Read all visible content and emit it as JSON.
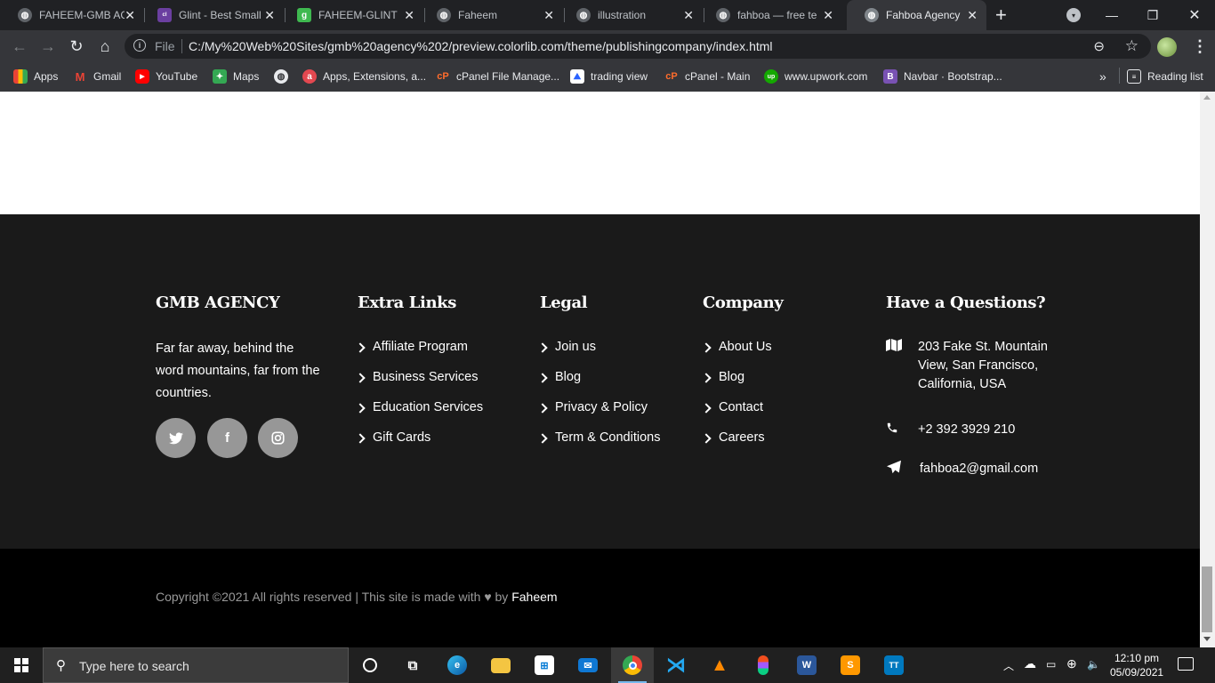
{
  "browser": {
    "tabs": [
      {
        "title": "FAHEEM-GMB AGENCY",
        "favicon": "globe-icon",
        "active": false
      },
      {
        "title": "Glint - Best Small",
        "favicon": "colorlib-icon",
        "active": false
      },
      {
        "title": "FAHEEM-GLINT",
        "favicon": "g-icon",
        "active": false
      },
      {
        "title": "Faheem",
        "favicon": "globe-icon",
        "active": false
      },
      {
        "title": "illustration",
        "favicon": "globe-icon",
        "active": false
      },
      {
        "title": "fahboa — free templates",
        "favicon": "globe-icon",
        "active": false
      },
      {
        "title": "Fahboa Agency",
        "favicon": "globe-icon",
        "active": true
      }
    ],
    "omnibox": {
      "scheme_label": "File",
      "url": "C:/My%20Web%20Sites/gmb%20agency%202/preview.colorlib.com/theme/publishingcompany/index.html"
    },
    "bookmarks": [
      {
        "label": "Apps",
        "icon": "apps-grid-icon",
        "color": "#ea4335"
      },
      {
        "label": "Gmail",
        "icon": "gmail-icon",
        "color": "#ea4335"
      },
      {
        "label": "YouTube",
        "icon": "youtube-icon",
        "color": "#ff0000"
      },
      {
        "label": "Maps",
        "icon": "maps-icon",
        "color": "#34a853"
      },
      {
        "label": "",
        "icon": "globe-icon",
        "color": "#e8eaed"
      },
      {
        "label": "Apps, Extensions, a...",
        "icon": "adobe-icon",
        "color": "#e34850"
      },
      {
        "label": "cPanel File Manage...",
        "icon": "cpanel-icon",
        "color": "#ff6c2c"
      },
      {
        "label": "trading view",
        "icon": "tradingview-icon",
        "color": "#2962ff"
      },
      {
        "label": "cPanel - Main",
        "icon": "cpanel-icon",
        "color": "#ff6c2c"
      },
      {
        "label": "www.upwork.com",
        "icon": "upwork-icon",
        "color": "#14a800"
      },
      {
        "label": "Navbar · Bootstrap...",
        "icon": "bootstrap-icon",
        "color": "#7952b3"
      }
    ],
    "overflow_label": "»",
    "reading_list_label": "Reading list"
  },
  "footer": {
    "columns": [
      {
        "title": "GMB AGENCY"
      },
      {
        "title": "Extra Links",
        "links": [
          "Affiliate Program",
          "Business Services",
          "Education Services",
          "Gift Cards"
        ]
      },
      {
        "title": "Legal",
        "links": [
          "Join us",
          "Blog",
          "Privacy & Policy",
          "Term & Conditions"
        ]
      },
      {
        "title": "Company",
        "links": [
          "About Us",
          "Blog",
          "Contact",
          "Careers"
        ]
      },
      {
        "title": "Have a Questions?"
      }
    ],
    "about_text": "Far far away, behind the word mountains, far from the countries.",
    "social": [
      {
        "name": "twitter-icon",
        "glyph": "🐦"
      },
      {
        "name": "facebook-icon",
        "glyph": "f"
      },
      {
        "name": "instagram-icon",
        "glyph": "◎"
      }
    ],
    "contact": {
      "address": "203 Fake St. Mountain View, San Francisco, California, USA",
      "phone": "+2 392 3929 210",
      "email": "fahboa2@gmail.com"
    },
    "copyright_prefix": "Copyright ©2021 All rights reserved | This site is made with",
    "copyright_by": "by",
    "copyright_author": "Faheem"
  },
  "taskbar": {
    "search_placeholder": "Type here to search",
    "apps": [
      "task-view-icon",
      "cortana-icon",
      "edge-icon",
      "file-explorer-icon",
      "store-icon",
      "mail-icon",
      "chrome-icon",
      "vscode-icon",
      "vlc-icon",
      "figma-icon",
      "word-icon",
      "sublime-icon",
      "trello-icon"
    ],
    "time": "12:10 pm",
    "date": "05/09/2021"
  },
  "colors": {
    "footer_bg": "#1a1a1a",
    "copyright_bg": "#000000",
    "social_bg": "#9aa4b0"
  }
}
